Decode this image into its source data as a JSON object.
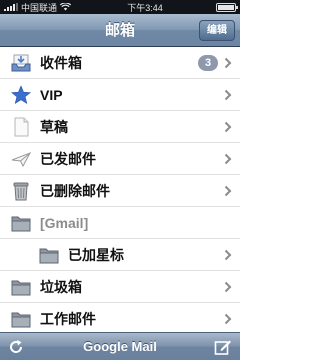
{
  "status": {
    "carrier": "中国联通",
    "time": "下午3:44"
  },
  "nav": {
    "title": "邮箱",
    "edit_label": "编辑"
  },
  "mailboxes": {
    "inbox": {
      "label": "收件箱",
      "count": "3"
    },
    "vip": {
      "label": "VIP"
    },
    "drafts": {
      "label": "草稿"
    },
    "sent": {
      "label": "已发邮件"
    },
    "trash": {
      "label": "已删除邮件"
    },
    "gmail_group": {
      "label": "[Gmail]"
    },
    "starred": {
      "label": "已加星标"
    },
    "junk": {
      "label": "垃圾箱"
    },
    "work": {
      "label": "工作邮件"
    }
  },
  "toolbar": {
    "title": "Google Mail"
  },
  "icons": {
    "inbox": "inbox-tray-icon",
    "vip": "star-icon",
    "drafts": "document-icon",
    "sent": "paper-plane-icon",
    "trash": "trash-can-icon",
    "folder": "folder-icon",
    "refresh": "refresh-icon",
    "compose": "compose-icon"
  },
  "colors": {
    "nav": "#7f97b2",
    "badge": "#8e9aac",
    "vip_star": "#3a6fcf"
  }
}
